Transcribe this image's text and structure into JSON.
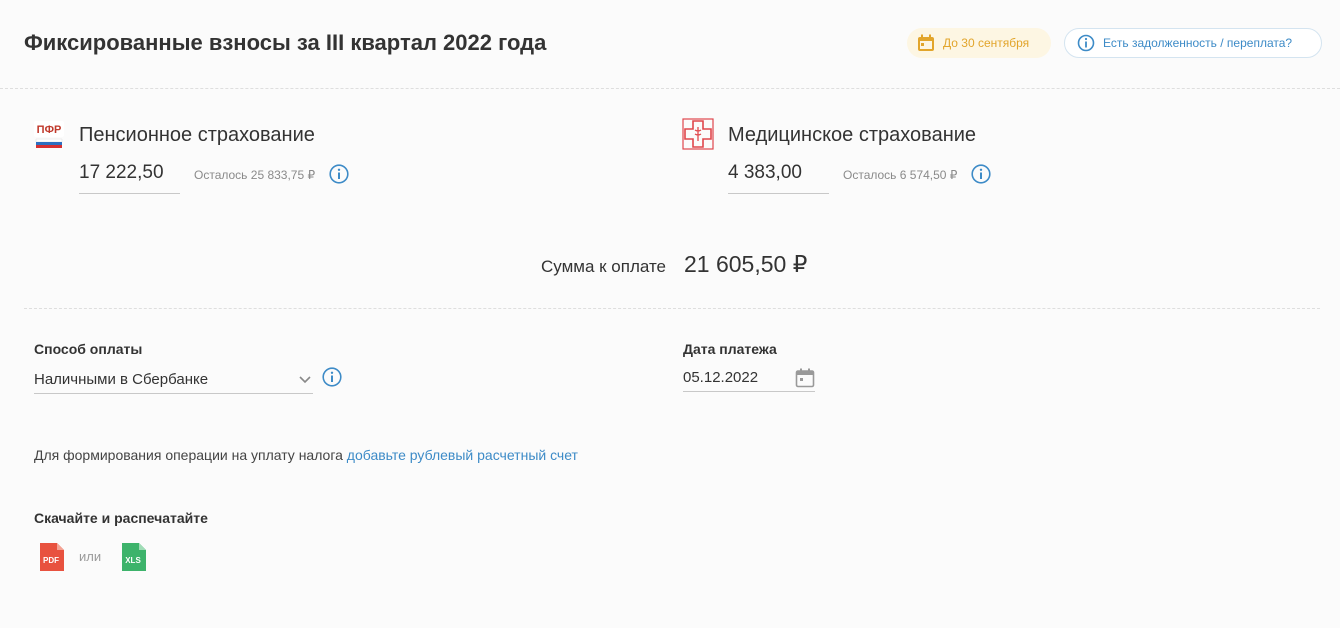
{
  "header": {
    "title": "Фиксированные взносы за III квартал 2022 года",
    "deadline_label": "До 30 сентября",
    "debt_label": "Есть задолженность / переплата?"
  },
  "pension": {
    "title": "Пенсионное страхование",
    "amount": "17 222,50",
    "remaining": "Осталось 25 833,75 ₽",
    "logo_text": "ПФР"
  },
  "medical": {
    "title": "Медицинское страхование",
    "amount": "4 383,00",
    "remaining": "Осталось 6 574,50 ₽"
  },
  "total": {
    "label": "Сумма к оплате",
    "value": "21 605,50 ₽"
  },
  "payment_method": {
    "label": "Способ оплаты",
    "value": "Наличными в Сбербанке"
  },
  "payment_date": {
    "label": "Дата платежа",
    "value": "05.12.2022"
  },
  "note": {
    "text": "Для формирования операции на уплату налога ",
    "link": "добавьте рублевый расчетный счет"
  },
  "download": {
    "label": "Скачайте и распечатайте",
    "pdf": "PDF",
    "or": "или",
    "xls": "XLS"
  },
  "colors": {
    "accent_blue": "#3d8bc7",
    "deadline_yellow": "#e2a52b",
    "medical_red": "#e0474c",
    "pdf_red": "#e8523f",
    "xls_green": "#3db36b"
  }
}
